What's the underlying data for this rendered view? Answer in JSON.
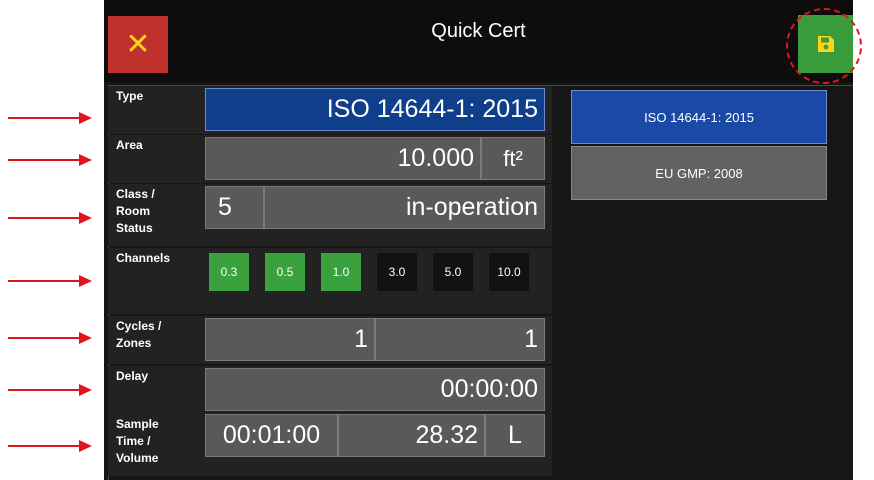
{
  "header": {
    "title": "Quick Cert",
    "close_glyph": "✕",
    "close_icon": "close-icon",
    "save_icon": "save-icon"
  },
  "form": {
    "type": {
      "label": "Type",
      "value": "ISO 14644-1: 2015"
    },
    "area": {
      "label": "Area",
      "value": "10.000",
      "unit": "ft²"
    },
    "class": {
      "label_lines": [
        "Class /",
        "Room",
        "Status"
      ],
      "class_value": "5",
      "status_value": "in-operation"
    },
    "channels": {
      "label": "Channels",
      "items": [
        {
          "value": "0.3",
          "active": true
        },
        {
          "value": "0.5",
          "active": true
        },
        {
          "value": "1.0",
          "active": true
        },
        {
          "value": "3.0",
          "active": false
        },
        {
          "value": "5.0",
          "active": false
        },
        {
          "value": "10.0",
          "active": false
        }
      ]
    },
    "cycles": {
      "label_lines": [
        "Cycles /",
        "Zones"
      ],
      "cycles": "1",
      "zones": "1"
    },
    "delay": {
      "label": "Delay",
      "value": "00:00:00"
    },
    "sample": {
      "label_lines": [
        "Sample",
        "Time /",
        "Volume"
      ],
      "time": "00:01:00",
      "volume": "28.32",
      "unit": "L"
    }
  },
  "standards": [
    {
      "label": "ISO 14644-1: 2015",
      "selected": true
    },
    {
      "label": "EU GMP: 2008",
      "selected": false
    }
  ],
  "colors": {
    "accent_red": "#c0302d",
    "save_green": "#3a9b3a",
    "selected_blue": "#1a4aa5",
    "annotation_red": "#e0141e"
  }
}
